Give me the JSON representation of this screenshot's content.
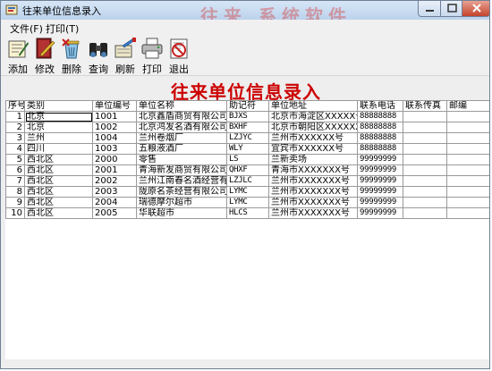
{
  "window": {
    "title": "往来单位信息录入",
    "background_banner": "往来 系统软件"
  },
  "menu": [
    {
      "label": "文件(F)"
    },
    {
      "label": "打印(T)"
    }
  ],
  "toolbar": {
    "add": "添加",
    "edit": "修改",
    "delete": "删除",
    "query": "查询",
    "refresh": "刷新",
    "print": "打印",
    "exit": "退出"
  },
  "form_title": "往来单位信息录入",
  "table": {
    "columns": [
      "序号",
      "类别",
      "单位编号",
      "单位名称",
      "助记符",
      "单位地址",
      "联系电话",
      "联系传真",
      "邮编"
    ],
    "rows": [
      [
        "1",
        "北京",
        "1001",
        "北京鑫盾商贸有限公司",
        "BJXS",
        "北京市海淀区XXXXX号",
        "88888888",
        "",
        ""
      ],
      [
        "2",
        "北京",
        "1002",
        "北京鸿发名酒有限公司",
        "BXHF",
        "北京市朝阳区XXXXXX号",
        "88888888",
        "",
        ""
      ],
      [
        "3",
        "兰州",
        "1004",
        "兰州卷烟厂",
        "LZJYC",
        "兰州市XXXXXX号",
        "88888888",
        "",
        ""
      ],
      [
        "4",
        "四川",
        "1003",
        "五粮液酒厂",
        "WLY",
        "宜宾市XXXXXX号",
        "88888888",
        "",
        ""
      ],
      [
        "5",
        "西北区",
        "2000",
        "零售",
        "LS",
        "兰新卖场",
        "99999999",
        "",
        ""
      ],
      [
        "6",
        "西北区",
        "2001",
        "青海新发商贸有限公司",
        "QHXF",
        "青海市XXXXXXX号",
        "99999999",
        "",
        ""
      ],
      [
        "7",
        "西北区",
        "2002",
        "兰州江南春名酒经营有限",
        "LZJLC",
        "兰州市XXXXXXX号",
        "99999999",
        "",
        ""
      ],
      [
        "8",
        "西北区",
        "2003",
        "陇原名茶经营有限公司",
        "LYMC",
        "兰州市XXXXXXX号",
        "99999999",
        "",
        ""
      ],
      [
        "9",
        "西北区",
        "2004",
        "瑞德摩尔超市",
        "LYMC",
        "兰州市XXXXXXX号",
        "99999999",
        "",
        ""
      ],
      [
        "10",
        "西北区",
        "2005",
        "华联超市",
        "HLCS",
        "兰州市XXXXXXX号",
        "99999999",
        "",
        ""
      ]
    ]
  },
  "colors": {
    "form_title": "#cc0000",
    "titlebar": "#c9dcf2",
    "close_button": "#c4432c"
  }
}
